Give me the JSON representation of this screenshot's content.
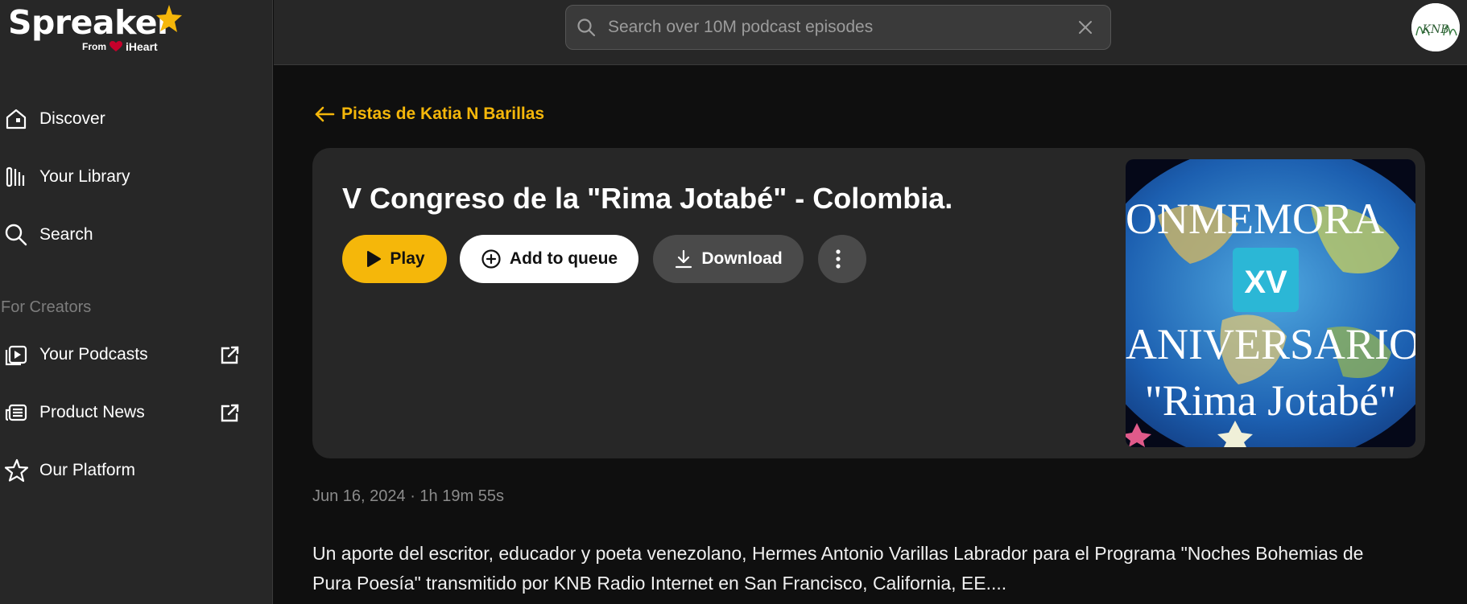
{
  "brand": {
    "name": "Spreaker",
    "from_label": "From",
    "partner": "iHeart"
  },
  "colors": {
    "accent": "#f5b70a",
    "sidebar_bg": "#272727",
    "main_bg": "#0f0f0f",
    "card_bg": "#272727"
  },
  "sidebar": {
    "items": [
      {
        "label": "Discover",
        "icon": "home-icon"
      },
      {
        "label": "Your Library",
        "icon": "library-icon"
      },
      {
        "label": "Search",
        "icon": "search-icon"
      }
    ],
    "section_label": "For Creators",
    "creator_items": [
      {
        "label": "Your Podcasts",
        "icon": "podcast-icon",
        "external": true
      },
      {
        "label": "Product News",
        "icon": "news-icon",
        "external": true
      },
      {
        "label": "Our Platform",
        "icon": "star-icon",
        "external": false
      }
    ]
  },
  "search": {
    "placeholder": "Search over 10M podcast episodes",
    "value": ""
  },
  "back_link": "Pistas de Katia N Barillas",
  "episode": {
    "title": "V Congreso de la \"Rima Jotabé\" - Colombia.",
    "buttons": {
      "play": "Play",
      "queue": "Add to queue",
      "download": "Download"
    },
    "cover_text": {
      "line1": "ONMEMORA",
      "badge": "XV",
      "line2": "ANIVERSARIO",
      "line3": "\"Rima Jotabé\""
    },
    "meta": "Jun 16, 2024 · 1h 19m 55s",
    "description": "Un aporte del escritor, educador y poeta venezolano, Hermes Antonio Varillas Labrador para el Programa \"Noches Bohemias de Pura Poesía\" transmitido por KNB Radio Internet en San Francisco, California, EE...."
  },
  "avatar": {
    "text": "KNB"
  }
}
